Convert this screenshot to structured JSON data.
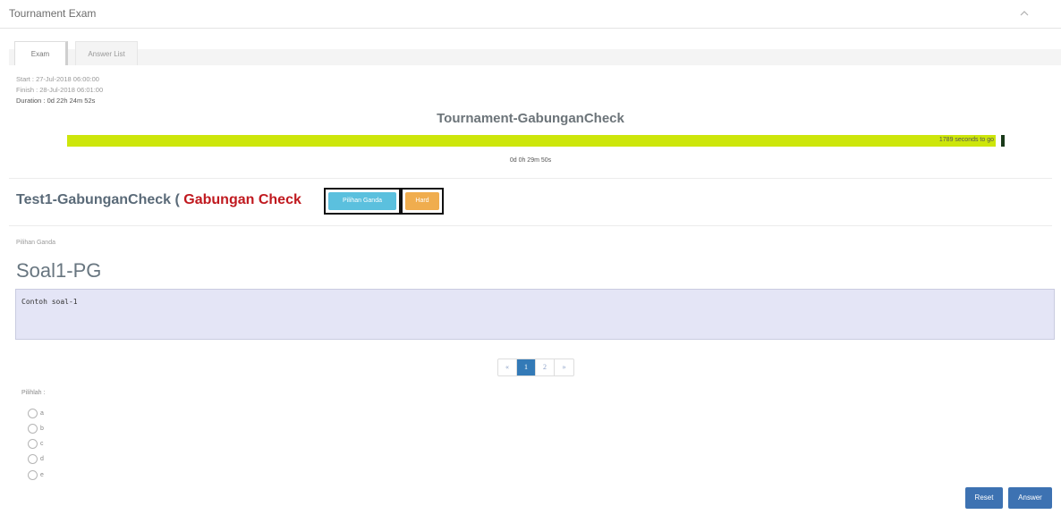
{
  "panel": {
    "title": "Tournament Exam"
  },
  "tabs": [
    {
      "label": "Exam",
      "active": true
    },
    {
      "label": "Answer List",
      "active": false
    }
  ],
  "schedule": {
    "start": "Start : 27-Jul-2018 06:00:00",
    "finish": "Finish : 28-Jul-2018 06:01:00",
    "duration": "Duration : 0d 22h 24m 52s"
  },
  "tournament": {
    "title": "Tournament-GabunganCheck",
    "progress_label": "1789 seconds to go",
    "progress_fraction": 0.99,
    "countdown": "0d 0h 29m 50s",
    "colors": {
      "bar": "#cde60b",
      "bar_end": "#1a3a1a"
    }
  },
  "test": {
    "name": "Test1-GabunganCheck (",
    "type": " Gabungan Check",
    "badge_pg": "Pilihan Ganda",
    "badge_level": "Hard"
  },
  "question": {
    "section_label": "Pilihan Ganda",
    "title": "Soal1-PG",
    "body": "Contoh soal-1"
  },
  "pagination": {
    "prev": "«",
    "pages": [
      "1",
      "2"
    ],
    "next": "»",
    "current": "1"
  },
  "answers": {
    "prompt": "Pilihlah :",
    "options": [
      "a",
      "b",
      "c",
      "d",
      "e"
    ]
  },
  "actions": {
    "reset": "Reset",
    "answer": "Answer"
  }
}
